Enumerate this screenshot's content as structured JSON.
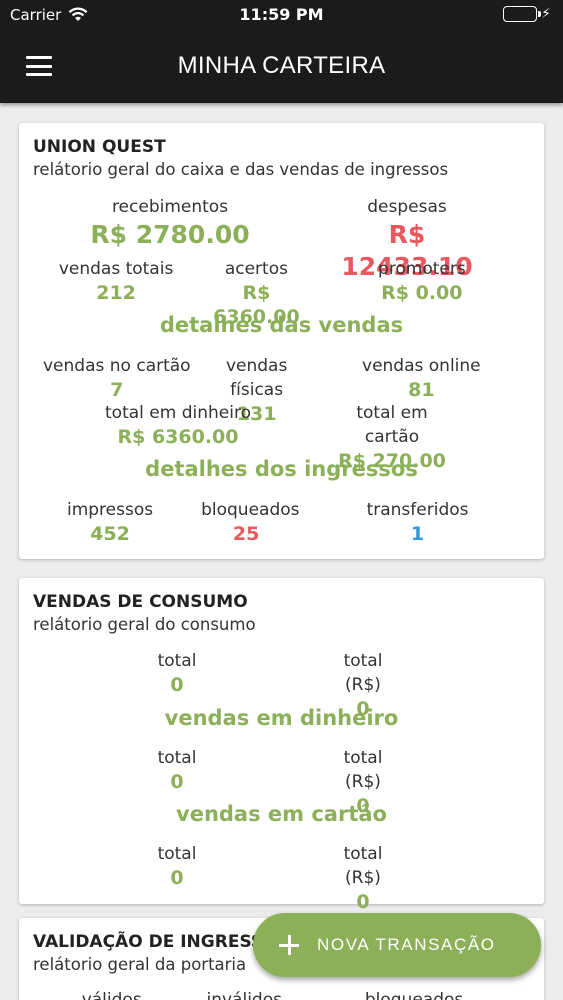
{
  "status_bar": {
    "carrier": "Carrier",
    "time": "11:59 PM"
  },
  "app_bar": {
    "title": "MINHA CARTEIRA"
  },
  "card1": {
    "title": "UNION QUEST",
    "subtitle": "relátorio geral do caixa e das vendas de ingressos",
    "recebimentos": {
      "label": "recebimentos",
      "value": "R$ 2780.00"
    },
    "despesas": {
      "label": "despesas",
      "value": "R$ 12433.10"
    },
    "vendas_totais": {
      "label": "vendas totais",
      "value": "212"
    },
    "acertos": {
      "label": "acertos",
      "value": "R$ 6360.00"
    },
    "promoters": {
      "label": "promoters",
      "value": "R$ 0.00"
    },
    "detalhes_vendas": "detalhes das vendas",
    "vendas_cartao": {
      "label": "vendas no cartão",
      "value": "7"
    },
    "vendas_fisicas": {
      "label": "vendas físicas",
      "value": "131"
    },
    "vendas_online": {
      "label": "vendas online",
      "value": "81"
    },
    "total_dinheiro": {
      "label": "total em dinheiro",
      "value": "R$ 6360.00"
    },
    "total_cartao": {
      "label": "total em cartão",
      "value": "R$ 270.00"
    },
    "detalhes_ingressos": "detalhes dos ingressos",
    "impressos": {
      "label": "impressos",
      "value": "452"
    },
    "bloqueados": {
      "label": "bloqueados",
      "value": "25"
    },
    "transferidos": {
      "label": "transferidos",
      "value": "1"
    }
  },
  "card2": {
    "title": "VENDAS DE CONSUMO",
    "subtitle": "relátorio geral do consumo",
    "geral": {
      "total_label": "total",
      "total_value": "0",
      "total_rs_label": "total (R$)",
      "total_rs_value": "0"
    },
    "dinheiro_heading": "vendas em dinheiro",
    "dinheiro": {
      "total_label": "total",
      "total_value": "0",
      "total_rs_label": "total (R$)",
      "total_rs_value": "0"
    },
    "cartao_heading": "vendas em cartão",
    "cartao": {
      "total_label": "total",
      "total_value": "0",
      "total_rs_label": "total (R$)",
      "total_rs_value": "0"
    }
  },
  "card3": {
    "title": "VALIDAÇÃO DE INGRESSOS",
    "subtitle": "relátorio geral da portaria",
    "columns": [
      "válidos",
      "inválidos",
      "bloqueados"
    ]
  },
  "fab": {
    "label": "NOVA TRANSAÇÃO"
  },
  "colors": {
    "accent_green": "#8bb057",
    "red": "#e9575f",
    "blue": "#2b9bd8",
    "bar": "#1b1b1b"
  }
}
